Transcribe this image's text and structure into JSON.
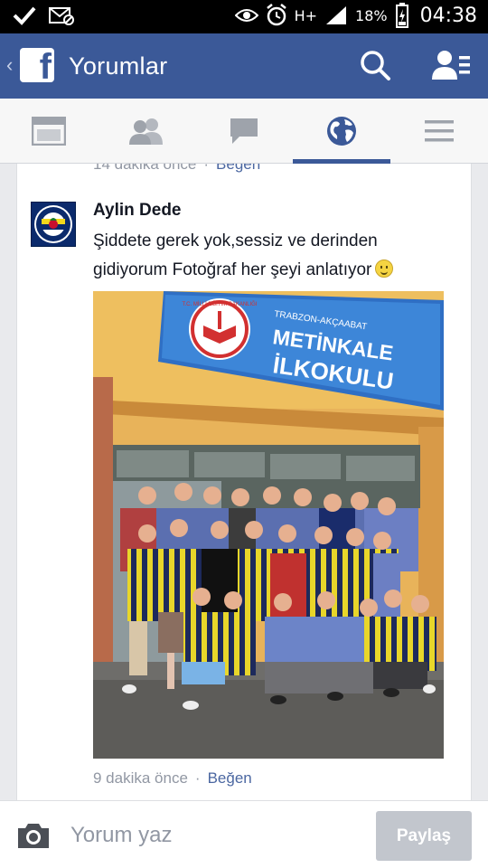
{
  "status_bar": {
    "battery": "18%",
    "time": "04:38",
    "network": "H+"
  },
  "header": {
    "title": "Yorumlar",
    "color": "#3b5998",
    "icons": [
      "facebook-logo",
      "search-icon",
      "friend-requests-icon"
    ]
  },
  "tabs": [
    {
      "name": "news-feed",
      "icon": "news-feed-icon",
      "active": false
    },
    {
      "name": "friends",
      "icon": "friends-icon",
      "active": false
    },
    {
      "name": "messages",
      "icon": "chat-bubble-icon",
      "active": false
    },
    {
      "name": "notifications",
      "icon": "globe-icon",
      "active": true
    },
    {
      "name": "more",
      "icon": "menu-icon",
      "active": false
    }
  ],
  "previous_comment": {
    "time": "14 dakika önce",
    "separator": "·",
    "like_label": "Beğen"
  },
  "comment": {
    "author": "Aylin Dede",
    "text": "Şiddete gerek yok,sessiz ve derinden gidiyorum Fotoğraf her şeyi anlatıyor",
    "time": "9 dakika önce",
    "separator": "·",
    "like_label": "Beğen",
    "photo": {
      "sign_top": "TRABZON-AKÇAABAT",
      "sign_line1": "METİNKALE",
      "sign_line2": "İLKOKULU",
      "ministry_arc": "T.C. MİLLİ EĞİTİM BAKANLIĞI"
    }
  },
  "composer": {
    "placeholder": "Yorum yaz",
    "send_label": "Paylaş"
  }
}
